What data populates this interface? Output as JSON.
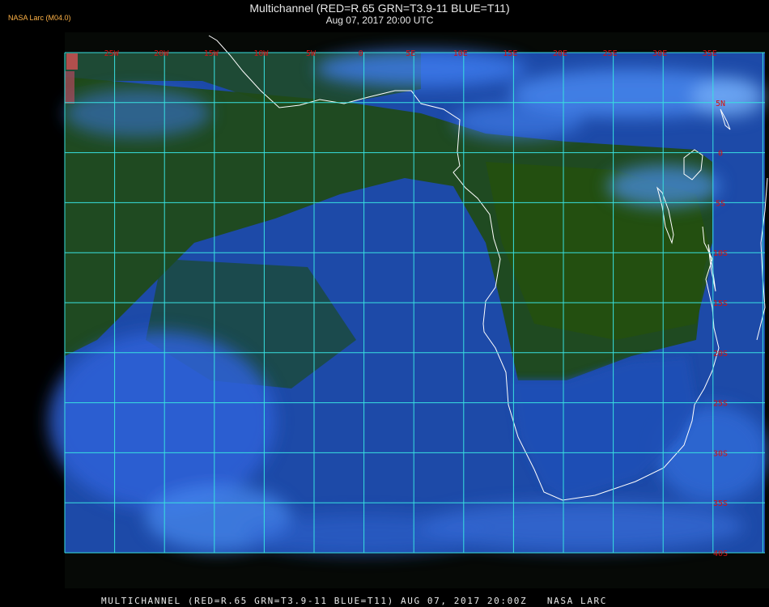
{
  "header": {
    "credit": "NASA Larc (M04.0)",
    "title": "Multichannel (RED=R.65 GRN=T3.9-11 BLUE=T11)",
    "datetime": "Aug 07, 2017 20:00 UTC"
  },
  "map": {
    "longitude_labels": [
      "25W",
      "20W",
      "15W",
      "10W",
      "5W",
      "0",
      "5E",
      "10E",
      "15E",
      "20E",
      "25E",
      "30E",
      "35E"
    ],
    "latitude_labels": [
      "5N",
      "0",
      "5S",
      "10S",
      "15S",
      "20S",
      "25S",
      "30S",
      "35S",
      "40S"
    ],
    "grid_color": "#38e0e0",
    "label_color": "#d81010",
    "coastline_color": "#ffffff",
    "ocean_color": "#1f4fb8",
    "land_color": "#1f4a14"
  },
  "footer": {
    "caption": "MULTICHANNEL (RED=R.65 GRN=T3.9-11 BLUE=T11) AUG 07, 2017 20:00Z   NASA LARC"
  }
}
